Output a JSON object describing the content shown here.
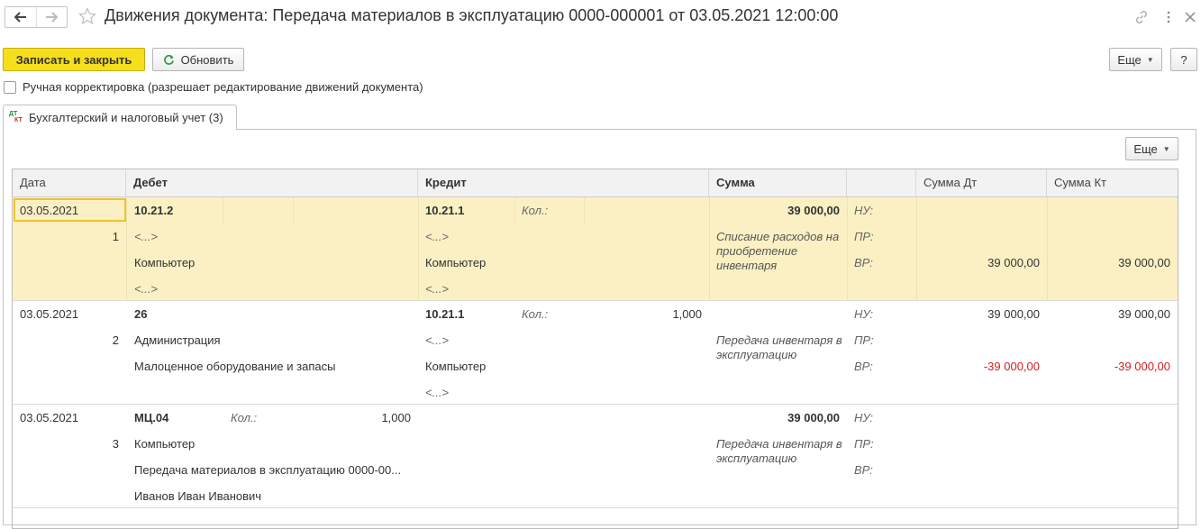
{
  "window": {
    "title": "Движения документа: Передача материалов в эксплуатацию 0000-000001 от 03.05.2021 12:00:00"
  },
  "toolbar": {
    "save_close": "Записать и закрыть",
    "refresh": "Обновить",
    "more": "Еще",
    "help": "?"
  },
  "manual_edit": {
    "label": "Ручная корректировка (разрешает редактирование движений документа)",
    "checked": false
  },
  "tab": {
    "label": "Бухгалтерский и налоговый учет (3)",
    "icon": "dt-kt-icon",
    "more": "Еще"
  },
  "columns": [
    "Дата",
    "Дебет",
    "Кредит",
    "Сумма",
    "",
    "Сумма Дт",
    "Сумма Кт"
  ],
  "rows": [
    {
      "date": "03.05.2021",
      "num": "1",
      "debit": {
        "account": "10.21.2",
        "sub": [
          "<...>",
          "Компьютер",
          "<...>"
        ]
      },
      "credit": {
        "account": "10.21.1",
        "qty_label": "Кол.:",
        "sub": [
          "<...>",
          "Компьютер",
          "<...>"
        ]
      },
      "sum": "39 000,00",
      "desc": "Списание расходов на приобретение инвентаря",
      "types": [
        "НУ:",
        "ПР:",
        "ВР:"
      ],
      "dt_nu": "",
      "kt_nu": "",
      "dt_vr": "39 000,00",
      "kt_vr": "39 000,00"
    },
    {
      "date": "03.05.2021",
      "num": "2",
      "debit": {
        "account": "26",
        "sub": [
          "Администрация",
          "Малоценное оборудование и запасы"
        ]
      },
      "credit": {
        "account": "10.21.1",
        "qty_label": "Кол.:",
        "qty": "1,000",
        "sub": [
          "<...>",
          "Компьютер",
          "<...>"
        ]
      },
      "sum": "",
      "desc": "Передача инвентаря в эксплуатацию",
      "types": [
        "НУ:",
        "ПР:",
        "ВР:"
      ],
      "dt_nu": "39 000,00",
      "kt_nu": "39 000,00",
      "dt_vr": "-39 000,00",
      "kt_vr": "-39 000,00"
    },
    {
      "date": "03.05.2021",
      "num": "3",
      "debit": {
        "account": "МЦ.04",
        "qty_label": "Кол.:",
        "qty": "1,000",
        "sub": [
          "Компьютер",
          "Передача материалов в эксплуатацию 0000-00...",
          "Иванов Иван Иванович"
        ]
      },
      "sum": "39 000,00",
      "desc": "Передача инвентаря в эксплуатацию",
      "types": [
        "НУ:",
        "ПР:",
        "ВР:"
      ]
    }
  ],
  "colors": {
    "primary_button": "#f6de1d",
    "selected_row": "#fbf0c3",
    "negative": "#d21f1f"
  }
}
